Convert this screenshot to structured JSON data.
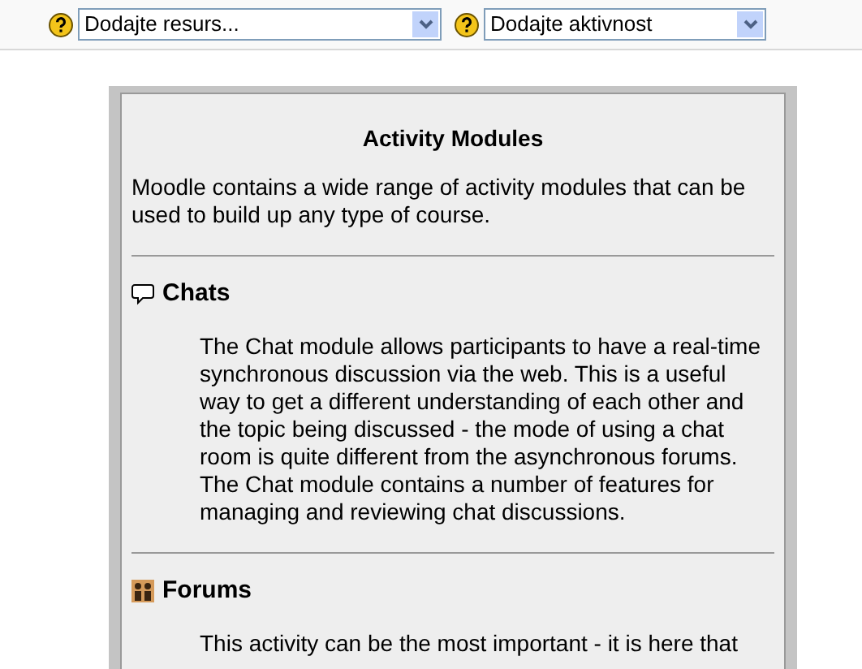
{
  "toolbar": {
    "selects": [
      {
        "value": "Dodajte resurs..."
      },
      {
        "value": "Dodajte aktivnost"
      }
    ]
  },
  "panel": {
    "title": "Activity Modules",
    "intro": "Moodle contains a wide range of activity modules that can be used to build up any type of course.",
    "sections": [
      {
        "kind": "chat",
        "heading": "Chats",
        "text": "The Chat module allows participants to have a real-time synchronous discussion via the web. This is a useful way to get a different understanding of each other and the topic being discussed - the mode of using a chat room is quite different from the asynchronous forums. The Chat module contains a number of features for managing and reviewing chat discussions."
      },
      {
        "kind": "forum",
        "heading": "Forums",
        "text": "This activity can be the most important - it is here that"
      }
    ]
  }
}
